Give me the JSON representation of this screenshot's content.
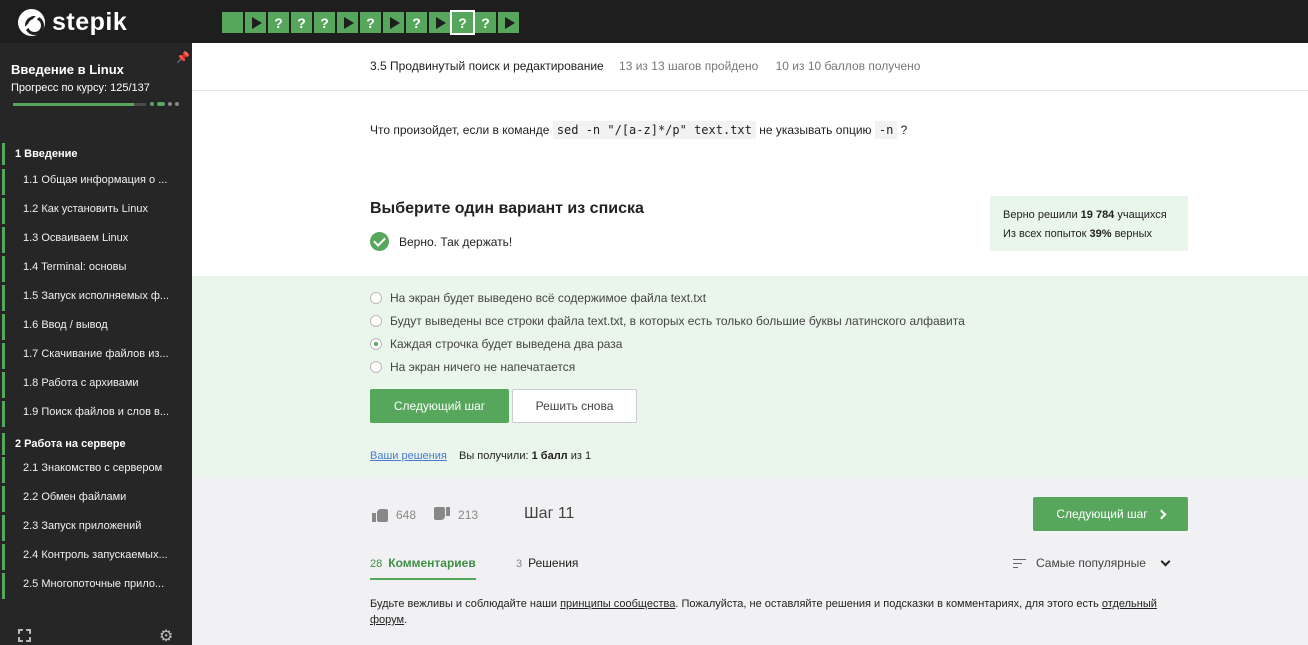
{
  "brand": {
    "logo_text": "stepik"
  },
  "step_nav": [
    {
      "state": "done"
    },
    {
      "state": "play"
    },
    {
      "state": "question",
      "label": "?"
    },
    {
      "state": "question",
      "label": "?"
    },
    {
      "state": "question",
      "label": "?"
    },
    {
      "state": "play"
    },
    {
      "state": "question",
      "label": "?"
    },
    {
      "state": "play"
    },
    {
      "state": "question",
      "label": "?"
    },
    {
      "state": "play"
    },
    {
      "state": "question",
      "label": "?",
      "active": true
    },
    {
      "state": "question",
      "label": "?"
    },
    {
      "state": "play"
    }
  ],
  "sidebar": {
    "course_title": "Введение в Linux",
    "progress_label": "Прогресс по курсу:  125/137",
    "progress_fraction": 0.9124,
    "sections": [
      {
        "title": "1  Введение",
        "lessons": [
          "1.1  Общая информация о ...",
          "1.2  Как установить Linux",
          "1.3  Осваиваем Linux",
          "1.4  Terminal: основы",
          "1.5  Запуск исполняемых ф...",
          "1.6  Ввод / вывод",
          "1.7  Скачивание файлов из...",
          "1.8  Работа с архивами",
          "1.9  Поиск файлов и слов в..."
        ]
      },
      {
        "title": "2  Работа на сервере",
        "lessons": [
          "2.1  Знакомство с сервером",
          "2.2  Обмен файлами",
          "2.3  Запуск приложений",
          "2.4  Контроль запускаемых...",
          "2.5  Многопоточные прило..."
        ]
      }
    ]
  },
  "header": {
    "lesson": "3.5 Продвинутый поиск и редактирование",
    "steps_done": "13 из 13 шагов пройдено",
    "points": "10 из 10 баллов  получено"
  },
  "question": {
    "before": "Что произойдет, если в команде ",
    "code1": "sed -n \"/[a-z]*/p\" text.txt",
    "middle": " не указывать опцию ",
    "code2": "-n",
    "after": " ?"
  },
  "quiz": {
    "title": "Выберите один вариант из списка",
    "feedback": "Верно. Так держать!",
    "stats_line1_pre": "Верно решили ",
    "stats_line1_num": "19 784",
    "stats_line1_post": " учащихся",
    "stats_line2_pre": "Из всех попыток ",
    "stats_line2_num": "39%",
    "stats_line2_post": " верных",
    "options": [
      "На экран будет выведено всё содержимое файла text.txt",
      "Будут выведены все строки файла text.txt, в которых есть только большие буквы латинского алфавита",
      "Каждая строчка будет выведена два раза",
      "На экран ничего не напечатается"
    ],
    "selected_index": 2,
    "next_button": "Следующий шаг",
    "retry_button": "Решить снова",
    "your_solutions": "Ваши решения",
    "got_pre": "Вы получили: ",
    "got_bold": "1 балл",
    "got_post": " из 1"
  },
  "footer": {
    "likes": "648",
    "dislikes": "213",
    "step_label": "Шаг 11",
    "next_button": "Следующий шаг",
    "tabs": [
      {
        "count": "28",
        "label": "Комментариев",
        "active": true
      },
      {
        "count": "3",
        "label": "Решения",
        "active": false
      }
    ],
    "sort_label": "Самые популярные",
    "notice_1": "Будьте вежливы и соблюдайте наши ",
    "notice_link1": "принципы сообщества",
    "notice_2": ". Пожалуйста, не оставляйте решения и подсказки в комментариях, для этого есть ",
    "notice_link2": "отдельный форум",
    "notice_3": "."
  },
  "colors": {
    "accent": "#56a65c",
    "topbar": "#1e1e1e",
    "sidebar": "#262626",
    "answers_bg": "#eaf6eb"
  }
}
